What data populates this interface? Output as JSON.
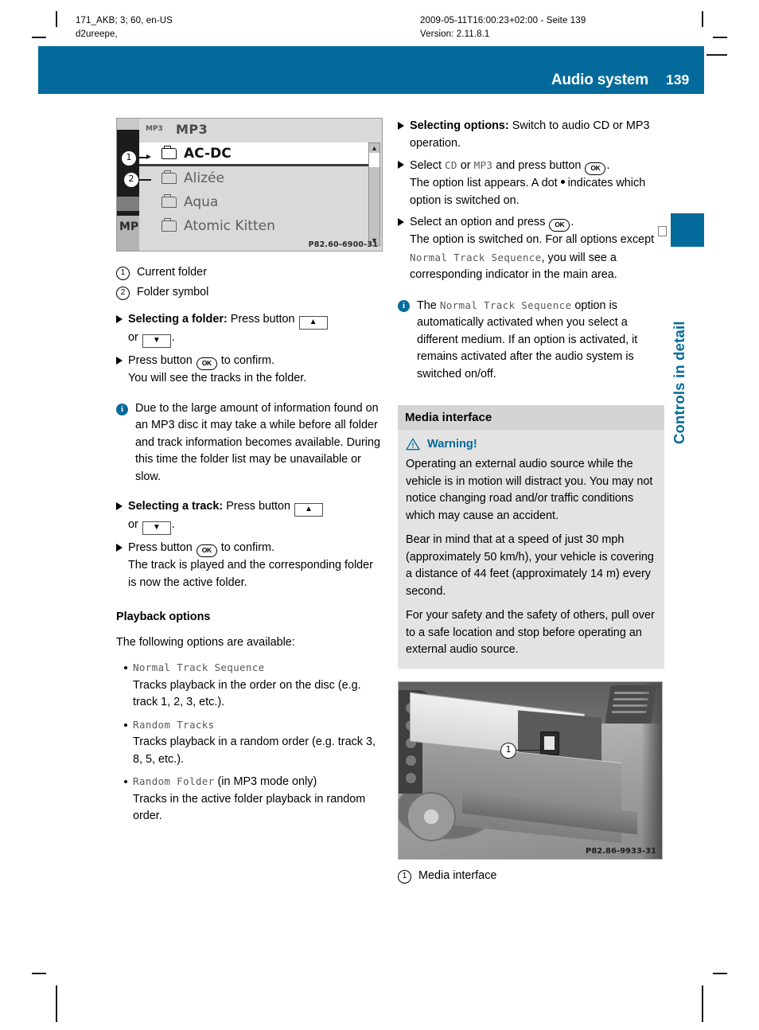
{
  "running_head": {
    "left_line1": "171_AKB; 3; 60, en-US",
    "left_line2": "d2ureepe,",
    "right_line1": "2009-05-11T16:00:23+02:00 - Seite 139",
    "right_line2": "Version: 2.11.8.1"
  },
  "header": {
    "title": "Audio system",
    "page_number": "139",
    "accent_color": "#036a9b"
  },
  "side_tab": {
    "label": "Controls in detail"
  },
  "figure_screen": {
    "title": "MP3",
    "disc_icon_label": "MP3",
    "left_strip_label": "MP",
    "rows": [
      {
        "label": "AC-DC",
        "selected": true
      },
      {
        "label": "Alizée",
        "selected": false
      },
      {
        "label": "Aqua",
        "selected": false
      },
      {
        "label": "Atomic Kitten",
        "selected": false
      }
    ],
    "callouts": [
      {
        "num": "1"
      },
      {
        "num": "2"
      }
    ],
    "image_code": "P82.60-6900-31"
  },
  "left_column": {
    "legend": [
      {
        "num": "1",
        "text": "Current folder"
      },
      {
        "num": "2",
        "text": "Folder symbol"
      }
    ],
    "step_select_folder": {
      "bold": "Selecting a folder:",
      "text_a": "Press button",
      "text_or": "or",
      "text_end": "."
    },
    "step_confirm_folder": {
      "line1_a": "Press button",
      "line1_b": "to confirm.",
      "line2": "You will see the tracks in the folder."
    },
    "note_mp3": "Due to the large amount of information found on an MP3 disc it may take a while before all folder and track information becomes available. During this time the folder list may be unavailable or slow.",
    "step_select_track": {
      "bold": "Selecting a track:",
      "text_a": "Press button",
      "text_or": "or",
      "text_end": "."
    },
    "step_confirm_track": {
      "line1_a": "Press button",
      "line1_b": "to confirm.",
      "line2": "The track is played and the corresponding folder is now the active folder."
    },
    "playback_heading": "Playback options",
    "playback_intro": "The following options are available:",
    "options": [
      {
        "name": "Normal Track Sequence",
        "suffix": "",
        "description": "Tracks playback in the order on the disc (e.g. track 1, 2, 3, etc.)."
      },
      {
        "name": "Random Tracks",
        "suffix": "",
        "description": "Tracks playback in a random order (e.g. track 3, 8, 5, etc.)."
      },
      {
        "name": "Random Folder",
        "suffix": " (in MP3 mode only)",
        "description": "Tracks in the active folder playback in random order."
      }
    ]
  },
  "right_column": {
    "step_selecting_options": {
      "bold": "Selecting options:",
      "text": "Switch to audio CD or MP3 operation."
    },
    "step_select_cd_mp3": {
      "line1_a": "Select",
      "mono_cd": "CD",
      "line1_or": "or",
      "mono_mp3": "MP3",
      "line1_b": "and press button",
      "line1_end": ".",
      "line2_a": "The option list appears. A dot",
      "line2_b": "indicates which option is switched on."
    },
    "step_select_option": {
      "line1_a": "Select an option and press",
      "line1_end": ".",
      "line2_a": "The option is switched on. For all options except",
      "mono": "Normal Track Sequence",
      "line2_b": ", you will see a corresponding indicator in the main area."
    },
    "note_normal": {
      "a": "The",
      "mono": "Normal Track Sequence",
      "b": "option is automatically activated when you select a different medium. If an option is activated, it remains activated after the audio system is switched on/off."
    },
    "media_heading": "Media interface",
    "warning": {
      "label": "Warning!",
      "paragraphs": [
        "Operating an external audio source while the vehicle is in motion will distract you. You may not notice changing road and/or traffic conditions which may cause an accident.",
        "Bear in mind that at a speed of just 30 mph (approximately 50 km/h), your vehicle is covering a distance of 44 feet (approximately 14 m) every second.",
        "For your safety and the safety of others, pull over to a safe location and stop before operating an external audio source."
      ]
    },
    "figure_photo": {
      "callout_num": "1",
      "image_code": "P82.86-9933-31"
    },
    "photo_legend": [
      {
        "num": "1",
        "text": "Media interface"
      }
    ]
  },
  "symbols": {
    "ok_button": "OK",
    "arrow_up": "▲",
    "arrow_down": "▼"
  }
}
